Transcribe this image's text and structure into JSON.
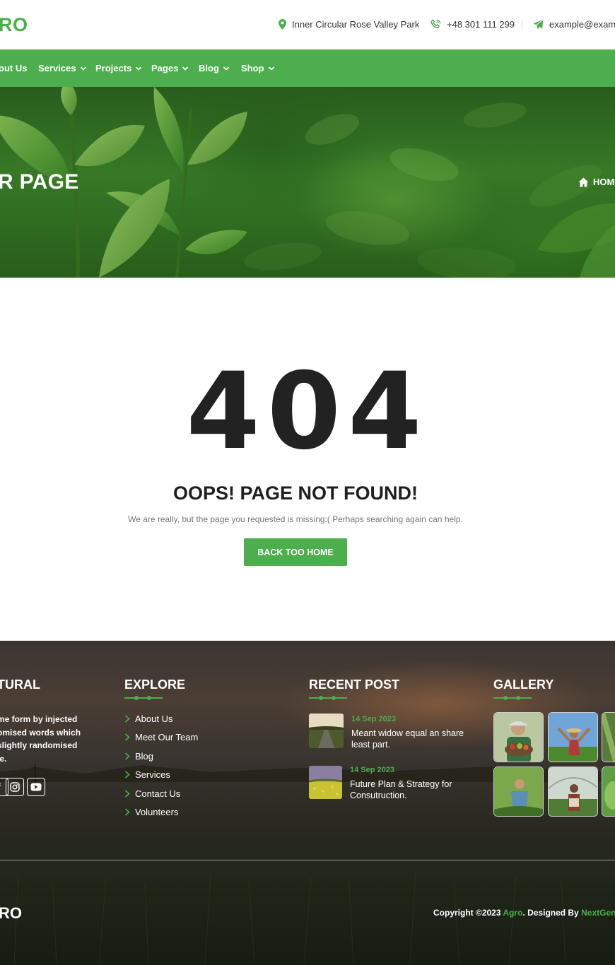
{
  "header": {
    "logo": "RO",
    "address": "Inner Circular Rose Valley Park",
    "phone": "+48 301 111 299",
    "email": "example@examp"
  },
  "nav": {
    "items": [
      {
        "label": "out Us",
        "has_dropdown": false
      },
      {
        "label": "Services",
        "has_dropdown": true
      },
      {
        "label": "Projects",
        "has_dropdown": true
      },
      {
        "label": "Pages",
        "has_dropdown": true
      },
      {
        "label": "Blog",
        "has_dropdown": true
      },
      {
        "label": "Shop",
        "has_dropdown": true
      }
    ]
  },
  "hero": {
    "title": "R PAGE",
    "breadcrumb": "HOM"
  },
  "error": {
    "code": "404",
    "title": "OOPS! PAGE NOT FOUND!",
    "message": "We are really, but the page you requested is missing:( Perhaps searching again can help.",
    "button": "BACK TOO HOME"
  },
  "footer": {
    "about": {
      "heading": "TURAL",
      "lines": [
        "me form by injected",
        "omised words which",
        "slightly randomised",
        "le."
      ]
    },
    "explore": {
      "heading": "EXPLORE",
      "links": [
        "About Us",
        "Meet Our Team",
        "Blog",
        "Services",
        "Contact Us",
        "Volunteers"
      ]
    },
    "recent": {
      "heading": "RECENT POST",
      "posts": [
        {
          "date": "14 Sep 2023",
          "title": "Meant widow equal an share least part."
        },
        {
          "date": "14 Sep 2023",
          "title": "Future Plan & Strategy for Consutruction."
        }
      ]
    },
    "gallery": {
      "heading": "GALLERY"
    },
    "logo": "RO",
    "copyright": {
      "prefix": "Copyright ©2023 ",
      "brand": "Agro",
      "middle": ". Designed By ",
      "designer": "NextGener"
    }
  },
  "colors": {
    "accent": "#4cae4c",
    "text_dark": "#222222",
    "text_muted": "#777777"
  }
}
